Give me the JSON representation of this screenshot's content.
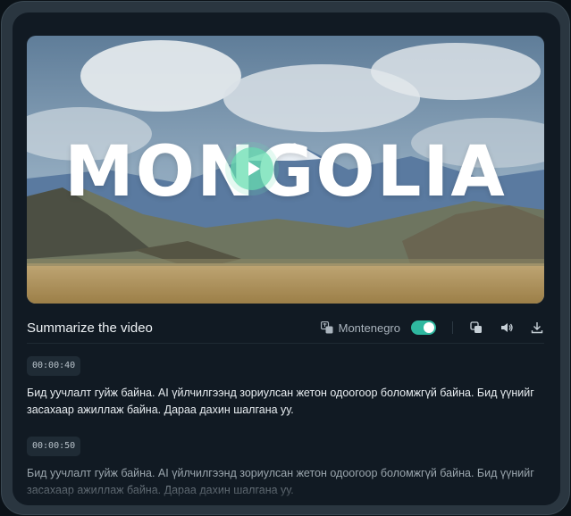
{
  "video": {
    "title": "MONGOLIA",
    "play_icon": "play-icon"
  },
  "toolbar": {
    "summary_title": "Summarize the video",
    "language_icon": "translate-icon",
    "language": "Montenegro",
    "toggle_on": true,
    "copy_icon": "copy-icon",
    "audio_icon": "speaker-icon",
    "download_icon": "download-icon"
  },
  "transcript": [
    {
      "time": "00:00:40",
      "text": "Бид уучлалт гуйж байна. AI үйлчилгээнд зориулсан жетон одоогоор боломжгүй байна. Бид үүнийг засахаар ажиллаж байна. Дараа дахин шалгана уу."
    },
    {
      "time": "00:00:50",
      "text": "Бид уучлалт гуйж байна. AI үйлчилгээнд зориулсан жетон одоогоор боломжгүй байна. Бид үүнийг засахаар ажиллаж байна. Дараа дахин шалгана уу."
    }
  ],
  "colors": {
    "accent": "#2fb8a0",
    "background": "#111a23",
    "frame": "#2a3640"
  }
}
